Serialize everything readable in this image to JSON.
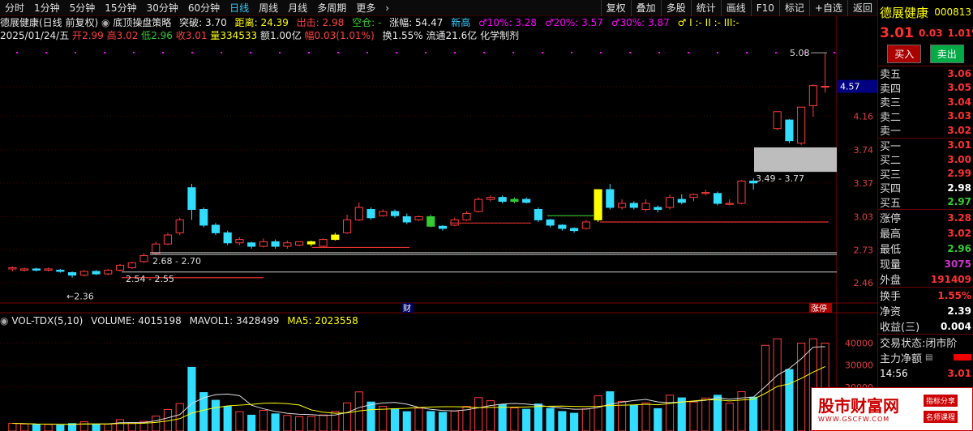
{
  "toolbar": {
    "periods": [
      "分时",
      "1分钟",
      "5分钟",
      "15分钟",
      "30分钟",
      "60分钟",
      "日线",
      "周线",
      "月线",
      "多周期",
      "更多"
    ],
    "active_index": 6,
    "right_buttons": [
      "复权",
      "叠加",
      "多股",
      "统计",
      "画线",
      "F10",
      "标记",
      "+自选",
      "返回"
    ]
  },
  "info": {
    "title": "德展健康(日线 前复权)",
    "strategy": "底顶操盘策略",
    "breakout_label": "突破:",
    "breakout_val": "3.70",
    "distance_label": "距离:",
    "distance_val": "24.39",
    "exit_label": "出击:",
    "exit_val": "2.98",
    "empty_label": "空仓:",
    "empty_dash": "-",
    "rise_label": "涨幅:",
    "rise_val": "54.47",
    "new_high": "新高",
    "pct10": "♂10%: 3.28",
    "pct20": "♂20%: 3.57",
    "pct30": "♂30%: 3.87",
    "levels": "♂ I :- II :- III:-",
    "date": "2025/01/24/五",
    "open_label": "开",
    "open": "2.99",
    "high_label": "高",
    "high": "3.02",
    "low_label": "低",
    "low": "2.96",
    "close_label": "收",
    "close": "3.01",
    "vol_label": "量",
    "vol": "334533",
    "amt_label": "额",
    "amt": "1.00亿",
    "amp_label": "幅",
    "amp": "0.03(1.01%)",
    "turnover": "换1.55%",
    "float": "流通21.6亿",
    "sector": "化学制剂"
  },
  "volume_indicator": {
    "name": "VOL-TDX(5,10)",
    "volume": "VOLUME: 4015198",
    "mavol1": "MAVOL1: 3428499",
    "ma5": "MA5: 2023558"
  },
  "chart_data": {
    "type": "candlestick",
    "y_ticks": [
      "4.57",
      "4.16",
      "3.74",
      "3.37",
      "3.03",
      "2.73",
      "2.46"
    ],
    "vol_ticks": [
      "40000",
      "30000",
      "20000"
    ],
    "annotations": {
      "peak": "5.08",
      "low_mark": "2.36",
      "zone1": "3.49 - 3.77",
      "zone2": "2.68 - 2.70",
      "zone3": "2.54 - 2.55",
      "fin_tag": "财",
      "limit_tag": "涨停",
      "current_price": "4.57"
    },
    "candles": [
      [
        2.57,
        2.58,
        2.59,
        2.55
      ],
      [
        2.56,
        2.57,
        2.58,
        2.55
      ],
      [
        2.57,
        2.56,
        2.58,
        2.55
      ],
      [
        2.56,
        2.57,
        2.58,
        2.55
      ],
      [
        2.56,
        2.55,
        2.57,
        2.54
      ],
      [
        2.54,
        2.52,
        2.55,
        2.5
      ],
      [
        2.52,
        2.55,
        2.56,
        2.51
      ],
      [
        2.55,
        2.53,
        2.56,
        2.52
      ],
      [
        2.53,
        2.56,
        2.57,
        2.52
      ],
      [
        2.56,
        2.6,
        2.61,
        2.55
      ],
      [
        2.58,
        2.62,
        2.63,
        2.57
      ],
      [
        2.63,
        2.68,
        2.7,
        2.62
      ],
      [
        2.7,
        2.78,
        2.8,
        2.69
      ],
      [
        2.78,
        2.86,
        2.88,
        2.77
      ],
      [
        2.88,
        3.0,
        3.02,
        2.86
      ],
      [
        3.32,
        3.1,
        3.36,
        3.0
      ],
      [
        3.1,
        2.95,
        3.12,
        2.93
      ],
      [
        2.95,
        2.88,
        2.97,
        2.86
      ],
      [
        2.88,
        2.79,
        2.9,
        2.77
      ],
      [
        2.79,
        2.82,
        2.84,
        2.77
      ],
      [
        2.79,
        2.76,
        2.8,
        2.74
      ],
      [
        2.76,
        2.8,
        2.83,
        2.75
      ],
      [
        2.8,
        2.76,
        2.82,
        2.74
      ],
      [
        2.76,
        2.79,
        2.81,
        2.74
      ],
      [
        2.77,
        2.8,
        2.8,
        2.76
      ],
      [
        2.78,
        2.8,
        2.81,
        2.76
      ],
      [
        2.76,
        2.82,
        2.83,
        2.75
      ],
      [
        2.82,
        2.86,
        2.88,
        2.81
      ],
      [
        2.88,
        3.0,
        3.05,
        2.87
      ],
      [
        3.0,
        3.12,
        3.17,
        2.99
      ],
      [
        3.1,
        3.02,
        3.12,
        3.0
      ],
      [
        3.04,
        3.08,
        3.1,
        3.03
      ],
      [
        3.08,
        3.04,
        3.1,
        3.02
      ],
      [
        3.03,
        2.98,
        3.06,
        2.96
      ],
      [
        3.0,
        3.03,
        3.04,
        2.99
      ],
      [
        3.03,
        2.94,
        3.05,
        2.93
      ],
      [
        2.94,
        2.92,
        2.95,
        2.9
      ],
      [
        2.95,
        3.0,
        3.02,
        2.94
      ],
      [
        3.0,
        3.06,
        3.08,
        2.99
      ],
      [
        3.08,
        3.2,
        3.22,
        3.07
      ],
      [
        3.2,
        3.22,
        3.24,
        3.18
      ],
      [
        3.22,
        3.18,
        3.24,
        3.16
      ],
      [
        3.18,
        3.2,
        3.22,
        3.16
      ],
      [
        3.2,
        3.17,
        3.22,
        3.16
      ],
      [
        3.1,
        3.0,
        3.12,
        2.98
      ],
      [
        3.0,
        2.95,
        3.01,
        2.93
      ],
      [
        2.95,
        2.92,
        2.96,
        2.9
      ],
      [
        2.92,
        2.9,
        2.93,
        2.88
      ],
      [
        2.92,
        2.98,
        3.0,
        2.91
      ],
      [
        3.0,
        3.3,
        3.3,
        2.98
      ],
      [
        3.3,
        3.12,
        3.36,
        3.1
      ],
      [
        3.12,
        3.16,
        3.2,
        3.1
      ],
      [
        3.16,
        3.12,
        3.18,
        3.1
      ],
      [
        3.1,
        3.16,
        3.2,
        3.08
      ],
      [
        3.12,
        3.1,
        3.14,
        3.07
      ],
      [
        3.12,
        3.22,
        3.25,
        3.1
      ],
      [
        3.2,
        3.17,
        3.25,
        3.15
      ],
      [
        3.22,
        3.25,
        3.26,
        3.18
      ],
      [
        3.26,
        3.27,
        3.3,
        3.24
      ],
      [
        3.26,
        3.16,
        3.28,
        3.14
      ],
      [
        3.15,
        3.16,
        3.2,
        3.14
      ],
      [
        3.16,
        3.39,
        3.4,
        3.15
      ],
      [
        3.39,
        3.37,
        3.42,
        3.3
      ],
      [
        3.7,
        3.73,
        3.75,
        3.69
      ],
      [
        4.0,
        4.22,
        4.22,
        3.98
      ],
      [
        4.11,
        3.85,
        4.12,
        3.82
      ],
      [
        3.82,
        4.28,
        4.28,
        3.8
      ],
      [
        4.3,
        4.58,
        4.6,
        4.15
      ],
      [
        4.57,
        4.57,
        5.08,
        4.48
      ]
    ],
    "volumes": [
      3500,
      3200,
      2800,
      3000,
      2600,
      3400,
      4200,
      2900,
      3100,
      5200,
      3800,
      4400,
      6800,
      9800,
      12500,
      29000,
      17500,
      14000,
      11200,
      8800,
      7200,
      9400,
      7800,
      7100,
      6500,
      6600,
      7300,
      8900,
      12800,
      17800,
      13200,
      11200,
      10100,
      8800,
      10400,
      8900,
      8500,
      9100,
      11200,
      15200,
      13800,
      12000,
      10500,
      9900,
      12300,
      10300,
      8900,
      8100,
      10100,
      16000,
      17900,
      13500,
      11800,
      12800,
      10200,
      16300,
      15100,
      13200,
      15000,
      16300,
      12700,
      17900,
      15400,
      39000,
      42000,
      28000,
      40000,
      42000,
      40000
    ]
  },
  "panel": {
    "name": "德展健康",
    "code": "000813",
    "price": "3.01",
    "change": "0.03",
    "change_pct": "1.01%",
    "buy_btn": "买入",
    "sell_btn": "卖出",
    "asks": [
      {
        "label": "卖五",
        "val": "3.06"
      },
      {
        "label": "卖四",
        "val": "3.05"
      },
      {
        "label": "卖三",
        "val": "3.04"
      },
      {
        "label": "卖二",
        "val": "3.03"
      },
      {
        "label": "卖一",
        "val": "3.02"
      }
    ],
    "bids": [
      {
        "label": "买一",
        "val": "3.01"
      },
      {
        "label": "买二",
        "val": "3.00"
      },
      {
        "label": "买三",
        "val": "2.99"
      },
      {
        "label": "买四",
        "val": "2.98"
      },
      {
        "label": "买五",
        "val": "2.97"
      }
    ],
    "stats1": [
      {
        "label": "涨停",
        "val": "3.28"
      },
      {
        "label": "最高",
        "val": "3.02"
      },
      {
        "label": "最低",
        "val": "2.96"
      },
      {
        "label": "现量",
        "val": "3075"
      },
      {
        "label": "外盘",
        "val": "191409"
      }
    ],
    "stats2": [
      {
        "label": "换手",
        "val": "1.55%"
      },
      {
        "label": "净资",
        "val": "2.39"
      },
      {
        "label": "收益(三)",
        "val": "0.004"
      }
    ],
    "trade_status": "交易状态:闭市阶",
    "net_flow": "主力净额",
    "time": "14:56",
    "time_price": "3.01"
  },
  "watermark": {
    "main": "股市财富网",
    "url": "WWW.GSCFW.COM",
    "tag1": "指标分享",
    "tag2": "名师课程"
  }
}
